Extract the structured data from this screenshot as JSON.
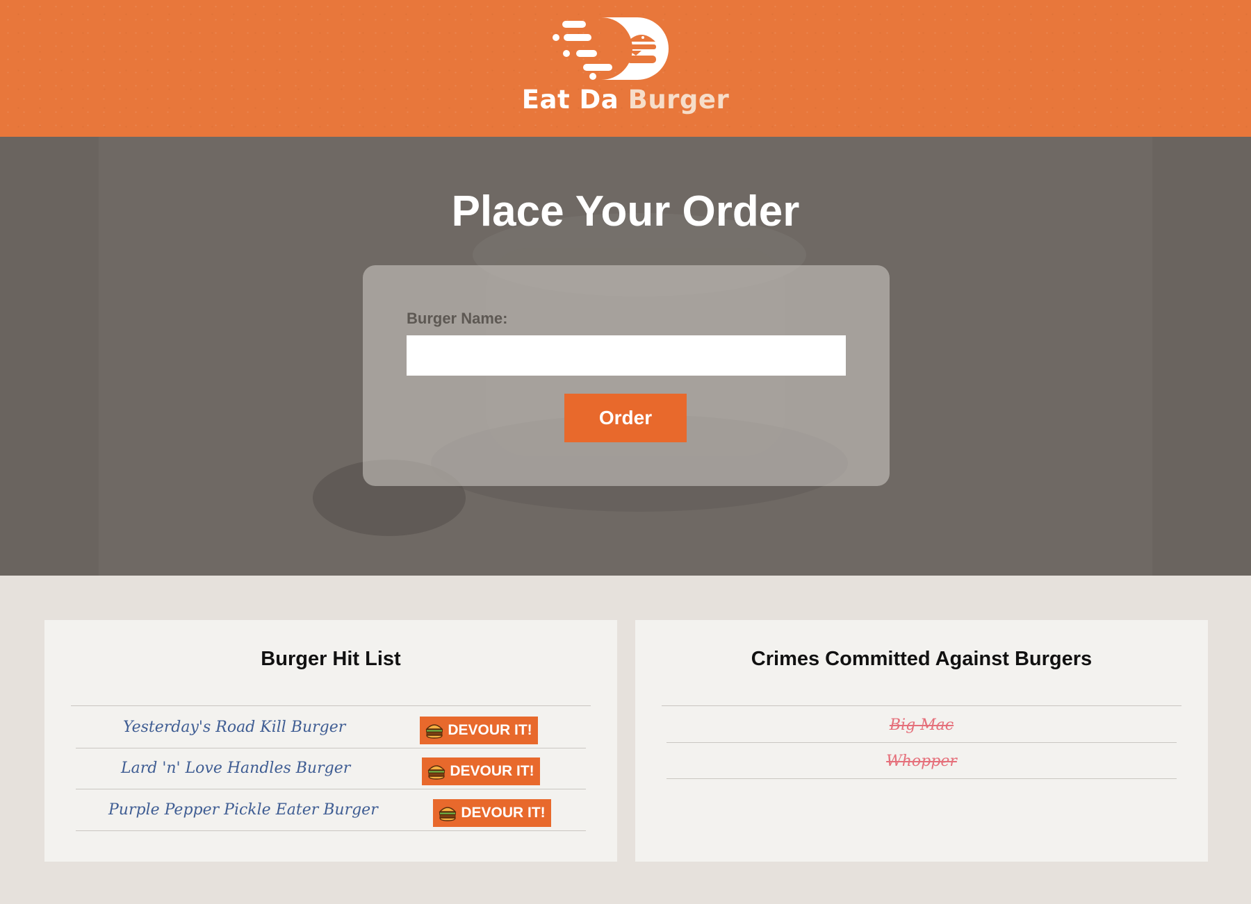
{
  "header": {
    "brand_main": "Eat Da ",
    "brand_accent": "Burger",
    "logo_icon": "speeding-burger-icon",
    "color": "#e8773b"
  },
  "hero": {
    "title": "Place Your Order",
    "form": {
      "label": "Burger Name:",
      "input_value": "",
      "input_placeholder": "",
      "submit_label": "Order"
    }
  },
  "hit_list": {
    "title": "Burger Hit List",
    "button_label": "DEVOUR IT!",
    "button_icon": "burger-icon",
    "items": [
      {
        "name": "Yesterday's Road Kill Burger"
      },
      {
        "name": "Lard 'n' Love Handles Burger"
      },
      {
        "name": "Purple Pepper Pickle Eater Burger"
      }
    ]
  },
  "crimes": {
    "title": "Crimes Committed Against Burgers",
    "items": [
      {
        "name": "Big Mac"
      },
      {
        "name": "Whopper"
      }
    ]
  },
  "colors": {
    "accent": "#e8692c",
    "devoured_text": "#e56f7a",
    "hit_list_text": "#3f5d93"
  }
}
